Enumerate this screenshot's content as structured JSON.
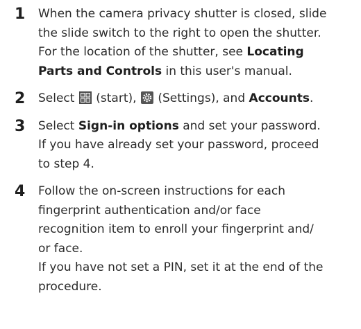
{
  "steps": [
    {
      "number": "1",
      "lines": [
        {
          "t1": "When the camera privacy shutter is closed, slide"
        },
        {
          "t1": "the slide switch to the right to open the shutter."
        },
        {
          "t1": "For the location of the shutter, see ",
          "b1": "Locating"
        },
        {
          "b1": "Parts and Controls",
          "t2": " in this user's manual."
        }
      ]
    },
    {
      "number": "2",
      "t1": "Select ",
      "icon1": "windows-start-icon",
      "t2": " (start), ",
      "icon2": "settings-gear-icon",
      "t3": " (Settings), and ",
      "b1": "Accounts",
      "t4": "."
    },
    {
      "number": "3",
      "lines": [
        {
          "t1": "Select ",
          "b1": "Sign-in options",
          "t2": " and set your password."
        },
        {
          "t1": "If you have already set your password, proceed"
        },
        {
          "t1": "to step 4."
        }
      ]
    },
    {
      "number": "4",
      "lines": [
        {
          "t1": "Follow the on-screen instructions for each"
        },
        {
          "t1": "fingerprint authentication and/or face"
        },
        {
          "t1": "recognition item to enroll your fingerprint and/"
        },
        {
          "t1": "or face."
        },
        {
          "t1": "If you have not set a PIN, set it at the end of the"
        },
        {
          "t1": "procedure."
        }
      ]
    }
  ],
  "colors": {
    "text": "#2b2b2b",
    "start_icon": "#4a4a4a",
    "gear_icon": "#555555"
  }
}
